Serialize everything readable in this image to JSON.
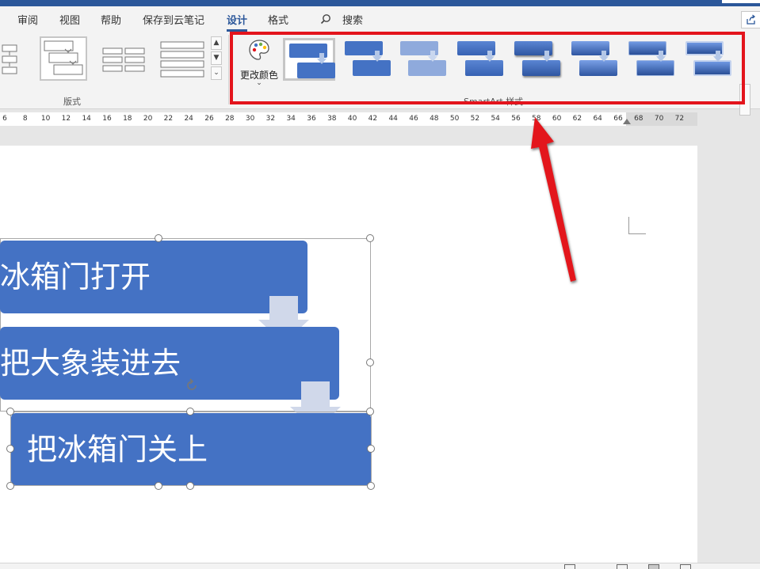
{
  "tabs": [
    {
      "label": "审阅"
    },
    {
      "label": "视图"
    },
    {
      "label": "帮助"
    },
    {
      "label": "保存到云笔记"
    },
    {
      "label": "设计"
    },
    {
      "label": "格式"
    }
  ],
  "search": {
    "label": "搜索",
    "icon": "search-icon"
  },
  "ribbon": {
    "layouts_group_label": "版式",
    "change_colors_label": "更改颜色",
    "styles_group_label": "SmartArt 样式"
  },
  "ruler": {
    "ticks": [
      "6",
      "8",
      "10",
      "12",
      "14",
      "16",
      "18",
      "20",
      "22",
      "24",
      "26",
      "28",
      "30",
      "32",
      "34",
      "36",
      "38",
      "40",
      "42",
      "44",
      "46",
      "48",
      "50",
      "52",
      "54",
      "56",
      "58",
      "60",
      "62",
      "64",
      "66",
      "68",
      "70",
      "72"
    ]
  },
  "smartart": {
    "steps": [
      "冰箱门打开",
      "把大象装进去",
      "把冰箱门关上"
    ]
  },
  "colors": {
    "accent": "#2b579a",
    "shape_fill": "#4472c4",
    "highlight": "#e3141c"
  }
}
